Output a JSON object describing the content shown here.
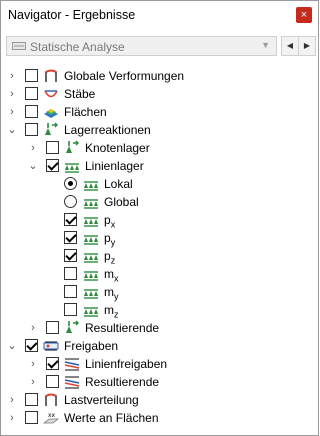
{
  "window": {
    "title": "Navigator - Ergebnisse",
    "close_label": "×"
  },
  "combo": {
    "value": "Statische Analyse",
    "icon": "static-analysis-icon"
  },
  "tree": {
    "globale_verformungen": "Globale Verformungen",
    "staebe": "Stäbe",
    "flaechen": "Flächen",
    "lagerreaktionen": "Lagerreaktionen",
    "knotenlager": "Knotenlager",
    "linienlager": "Linienlager",
    "lokal": "Lokal",
    "global": "Global",
    "px_main": "p",
    "px_sub": "x",
    "py_main": "p",
    "py_sub": "y",
    "pz_main": "p",
    "pz_sub": "z",
    "mx_main": "m",
    "mx_sub": "x",
    "my_main": "m",
    "my_sub": "y",
    "mz_main": "m",
    "mz_sub": "z",
    "resultierende_1": "Resultierende",
    "freigaben": "Freigaben",
    "linienfreigaben": "Linienfreigaben",
    "resultierende_2": "Resultierende",
    "lastverteilung": "Lastverteilung",
    "werte_an_flaechen": "Werte an Flächen"
  },
  "colors": {
    "accent_green": "#2e8b3e",
    "close_red": "#c42b1c"
  }
}
